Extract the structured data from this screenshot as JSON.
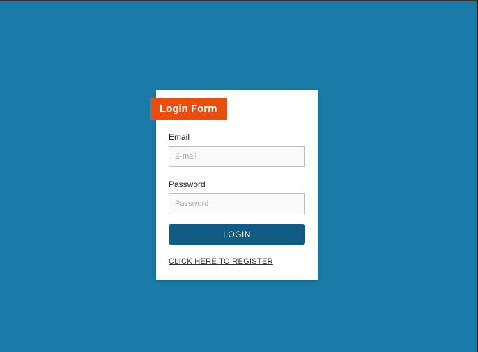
{
  "form": {
    "title": "Login Form",
    "email_label": "Email",
    "email_placeholder": "E-mail",
    "password_label": "Password",
    "password_placeholder": "Password",
    "login_button": "LOGIN",
    "register_link": "CLICK HERE TO REGISTER"
  }
}
